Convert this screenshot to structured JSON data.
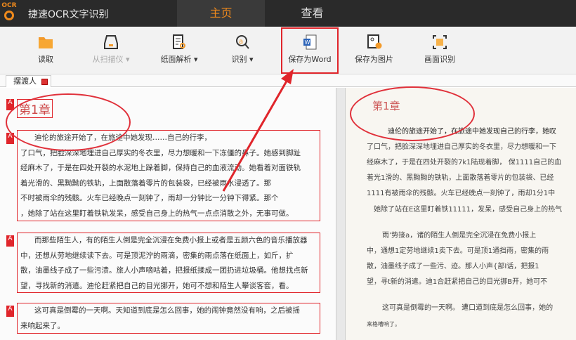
{
  "app": {
    "logo_text": "OCR",
    "title": "捷速OCR文字识别"
  },
  "nav": {
    "tabs": [
      {
        "label": "主页",
        "active": true
      },
      {
        "label": "查看",
        "active": false
      }
    ]
  },
  "toolbar": {
    "items": [
      {
        "label": "读取",
        "icon": "folder-icon"
      },
      {
        "label": "从扫描仪 ▾",
        "icon": "scanner-icon",
        "disabled": true
      },
      {
        "label": "纸面解析 ▾",
        "icon": "page-analyze-icon"
      },
      {
        "label": "识别 ▾",
        "icon": "recognize-icon"
      },
      {
        "label": "保存为Word",
        "icon": "word-icon"
      },
      {
        "label": "保存为图片",
        "icon": "save-image-icon"
      },
      {
        "label": "画面识别",
        "icon": "screen-capture-icon"
      }
    ]
  },
  "doc_tab": {
    "label": "摆渡人"
  },
  "left": {
    "heading": "第1章",
    "blocks": [
      [
        "迪伦的旅途开始了，在旅途中她发现……自己的行李，",
        "了口气，把脸深深地埋进自己厚实的冬衣里，尽力想暖和一下冻僵的鼻子。她感到脚趾",
        "经麻木了，于是在四处开裂的水泥地上跺着脚，保持自己的血液流动。她看着对面铁轨",
        "着光滑的、黑黝黝的铁轨，上面散落着零片的包装袋，已经被雨水浸透了。那",
        "不时被雨伞的残骸。火车已经晚点一刻钟了，雨却一分钟比一分钟下得紧。那个",
        "，她除了站在这里盯着铁轨发呆，感受自己身上的热气一点点消散之外，无事可做。"
      ],
      [
        "而那些陌生人，有的陌生人倒是完全沉浸在免费小报上或者是五颜六色的音乐播放器",
        "中，还想从劳地继续读下去。可是顶泥泞的雨滴，密集的雨点落在纸面上，如斤，扩",
        "散，油墨线子成了一些污渍。旅人小声嘀咕着，把报纸揉成一团扔进垃圾桶。他想找点新",
        "望，寻找新的消遣。迪伦赶紧把自己的目光挪开，她可不想和陌生人攀谈客套，看。"
      ],
      [
        "这可真是倒霉的一天啊。天知道到底是怎么回事，她的闹钟竟然没有响，之后被摇",
        "来响起来了。"
      ]
    ]
  },
  "right": {
    "heading": "第1章",
    "paragraphs": [
      "迪伦的旅途开始了，在旅途中她发现自己的行李，她叹",
      "了口气，把脸深深地埋进自己厚实的冬衣里，尽力想暖和一下",
      "经麻木了，于是在四处开裂的7k1陆现着脚， 保1111自己的血",
      "着光1滑的、黑黝黝的铁轨，上面散落着零片的包装袋、已经",
      "1111有被雨伞的残骸。火车已经晚点一刻钟了，雨却1分1中",
      "她除了站在E这里盯着铁11111，发呆，感受自己身上的热气",
      "雨’势接a，诸的陌生人倒是完全沉浸在免费小报上",
      "中，通想1定劳地继续1卖下去。可是顶1通挡雨，密集的雨",
      "散，油墨线子成了一些污、迹。那人小声{部I话，把报1",
      "望，寻t新的消遣。迪1合赶紧把自己的目光挪B开，她可不",
      "这可真是倒霉的一天啊。 遭口道到底是怎么回事，她的",
      "来格嘈响了。"
    ]
  },
  "colors": {
    "accent": "#f08a1c",
    "annotation": "#e0252b"
  }
}
